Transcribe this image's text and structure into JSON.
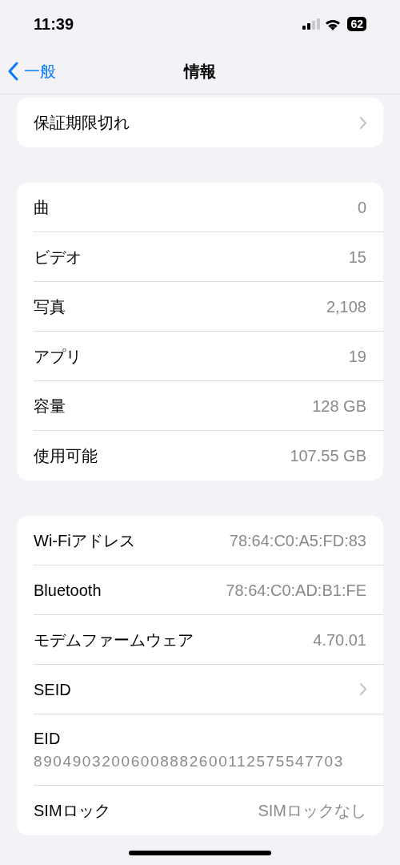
{
  "status_bar": {
    "time": "11:39",
    "battery": "62"
  },
  "nav": {
    "back": "一般",
    "title": "情報"
  },
  "sections": [
    [
      {
        "kind": "link",
        "label": "保証期限切れ"
      }
    ],
    [
      {
        "kind": "value",
        "label": "曲",
        "value": "0"
      },
      {
        "kind": "value",
        "label": "ビデオ",
        "value": "15"
      },
      {
        "kind": "value",
        "label": "写真",
        "value": "2,108"
      },
      {
        "kind": "value",
        "label": "アプリ",
        "value": "19"
      },
      {
        "kind": "value",
        "label": "容量",
        "value": "128 GB"
      },
      {
        "kind": "value",
        "label": "使用可能",
        "value": "107.55 GB"
      }
    ],
    [
      {
        "kind": "value",
        "label": "Wi-Fiアドレス",
        "value": "78:64:C0:A5:FD:83"
      },
      {
        "kind": "value",
        "label": "Bluetooth",
        "value": "78:64:C0:AD:B1:FE"
      },
      {
        "kind": "value",
        "label": "モデムファームウェア",
        "value": "4.70.01"
      },
      {
        "kind": "link",
        "label": "SEID"
      },
      {
        "kind": "stacked",
        "label": "EID",
        "value": "89049032006008882600112575547703"
      },
      {
        "kind": "value",
        "label": "SIMロック",
        "value": "SIMロックなし"
      }
    ]
  ]
}
